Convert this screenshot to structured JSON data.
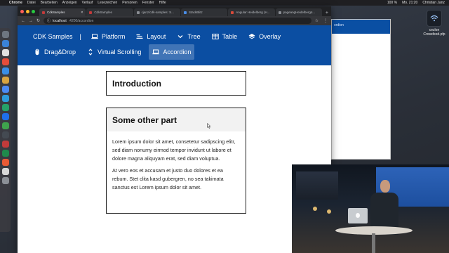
{
  "menubar": {
    "app": "Chrome",
    "items": [
      "Datei",
      "Bearbeiten",
      "Anzeigen",
      "Verlauf",
      "Lesezeichen",
      "Personen",
      "Fenster",
      "Hilfe"
    ],
    "battery": "100 %",
    "clock": "Mo. 21:20",
    "user": "Christian Janz"
  },
  "desktop": {
    "file_label": "cezlon Crossfeed.pfp"
  },
  "browser": {
    "tabs": [
      {
        "label": "CdkSamples",
        "active": true
      },
      {
        "label": "CdkSamples",
        "active": false
      },
      {
        "label": "cjanz/cdk-samples: S...",
        "active": false
      },
      {
        "label": "StackBlitz",
        "active": false
      },
      {
        "label": "Angular Heidelberg (H...",
        "active": false
      },
      {
        "label": "pageangHeidelbergü...",
        "active": false
      }
    ],
    "url_host": "localhost",
    "url_path": ":4200/accordion"
  },
  "bg_window": {
    "bar_text": "ordion"
  },
  "nav": {
    "brand": "CDK Samples",
    "separator": "|",
    "items": [
      {
        "label": "Platform",
        "icon": "laptop-icon"
      },
      {
        "label": "Layout",
        "icon": "layout-icon"
      },
      {
        "label": "Tree",
        "icon": "chevron-down-icon"
      },
      {
        "label": "Table",
        "icon": "table-icon"
      },
      {
        "label": "Overlay",
        "icon": "layers-icon"
      },
      {
        "label": "Drag&Drop",
        "icon": "mouse-icon"
      },
      {
        "label": "Virtual Scrolling",
        "icon": "scroll-icon"
      },
      {
        "label": "Accordion",
        "icon": "laptop-icon",
        "active": true
      }
    ]
  },
  "accordion": {
    "intro_title": "Introduction",
    "other_title": "Some other part",
    "paragraph_1": "Lorem ipsum dolor sit amet, consetetur sadipscing elitr, sed diam nonumy eirmod tempor invidunt ut labore et dolore magna aliquyam erat, sed diam voluptua.",
    "paragraph_2": "At vero eos et accusam et justo duo dolores et ea rebum. Stet clita kasd gubergren, no sea takimata sanctus est Lorem ipsum dolor sit amet."
  },
  "colors": {
    "nav_blue": "#0b4ea2",
    "chrome_dark": "#35363a",
    "panel_border": "#1e1e1e"
  }
}
